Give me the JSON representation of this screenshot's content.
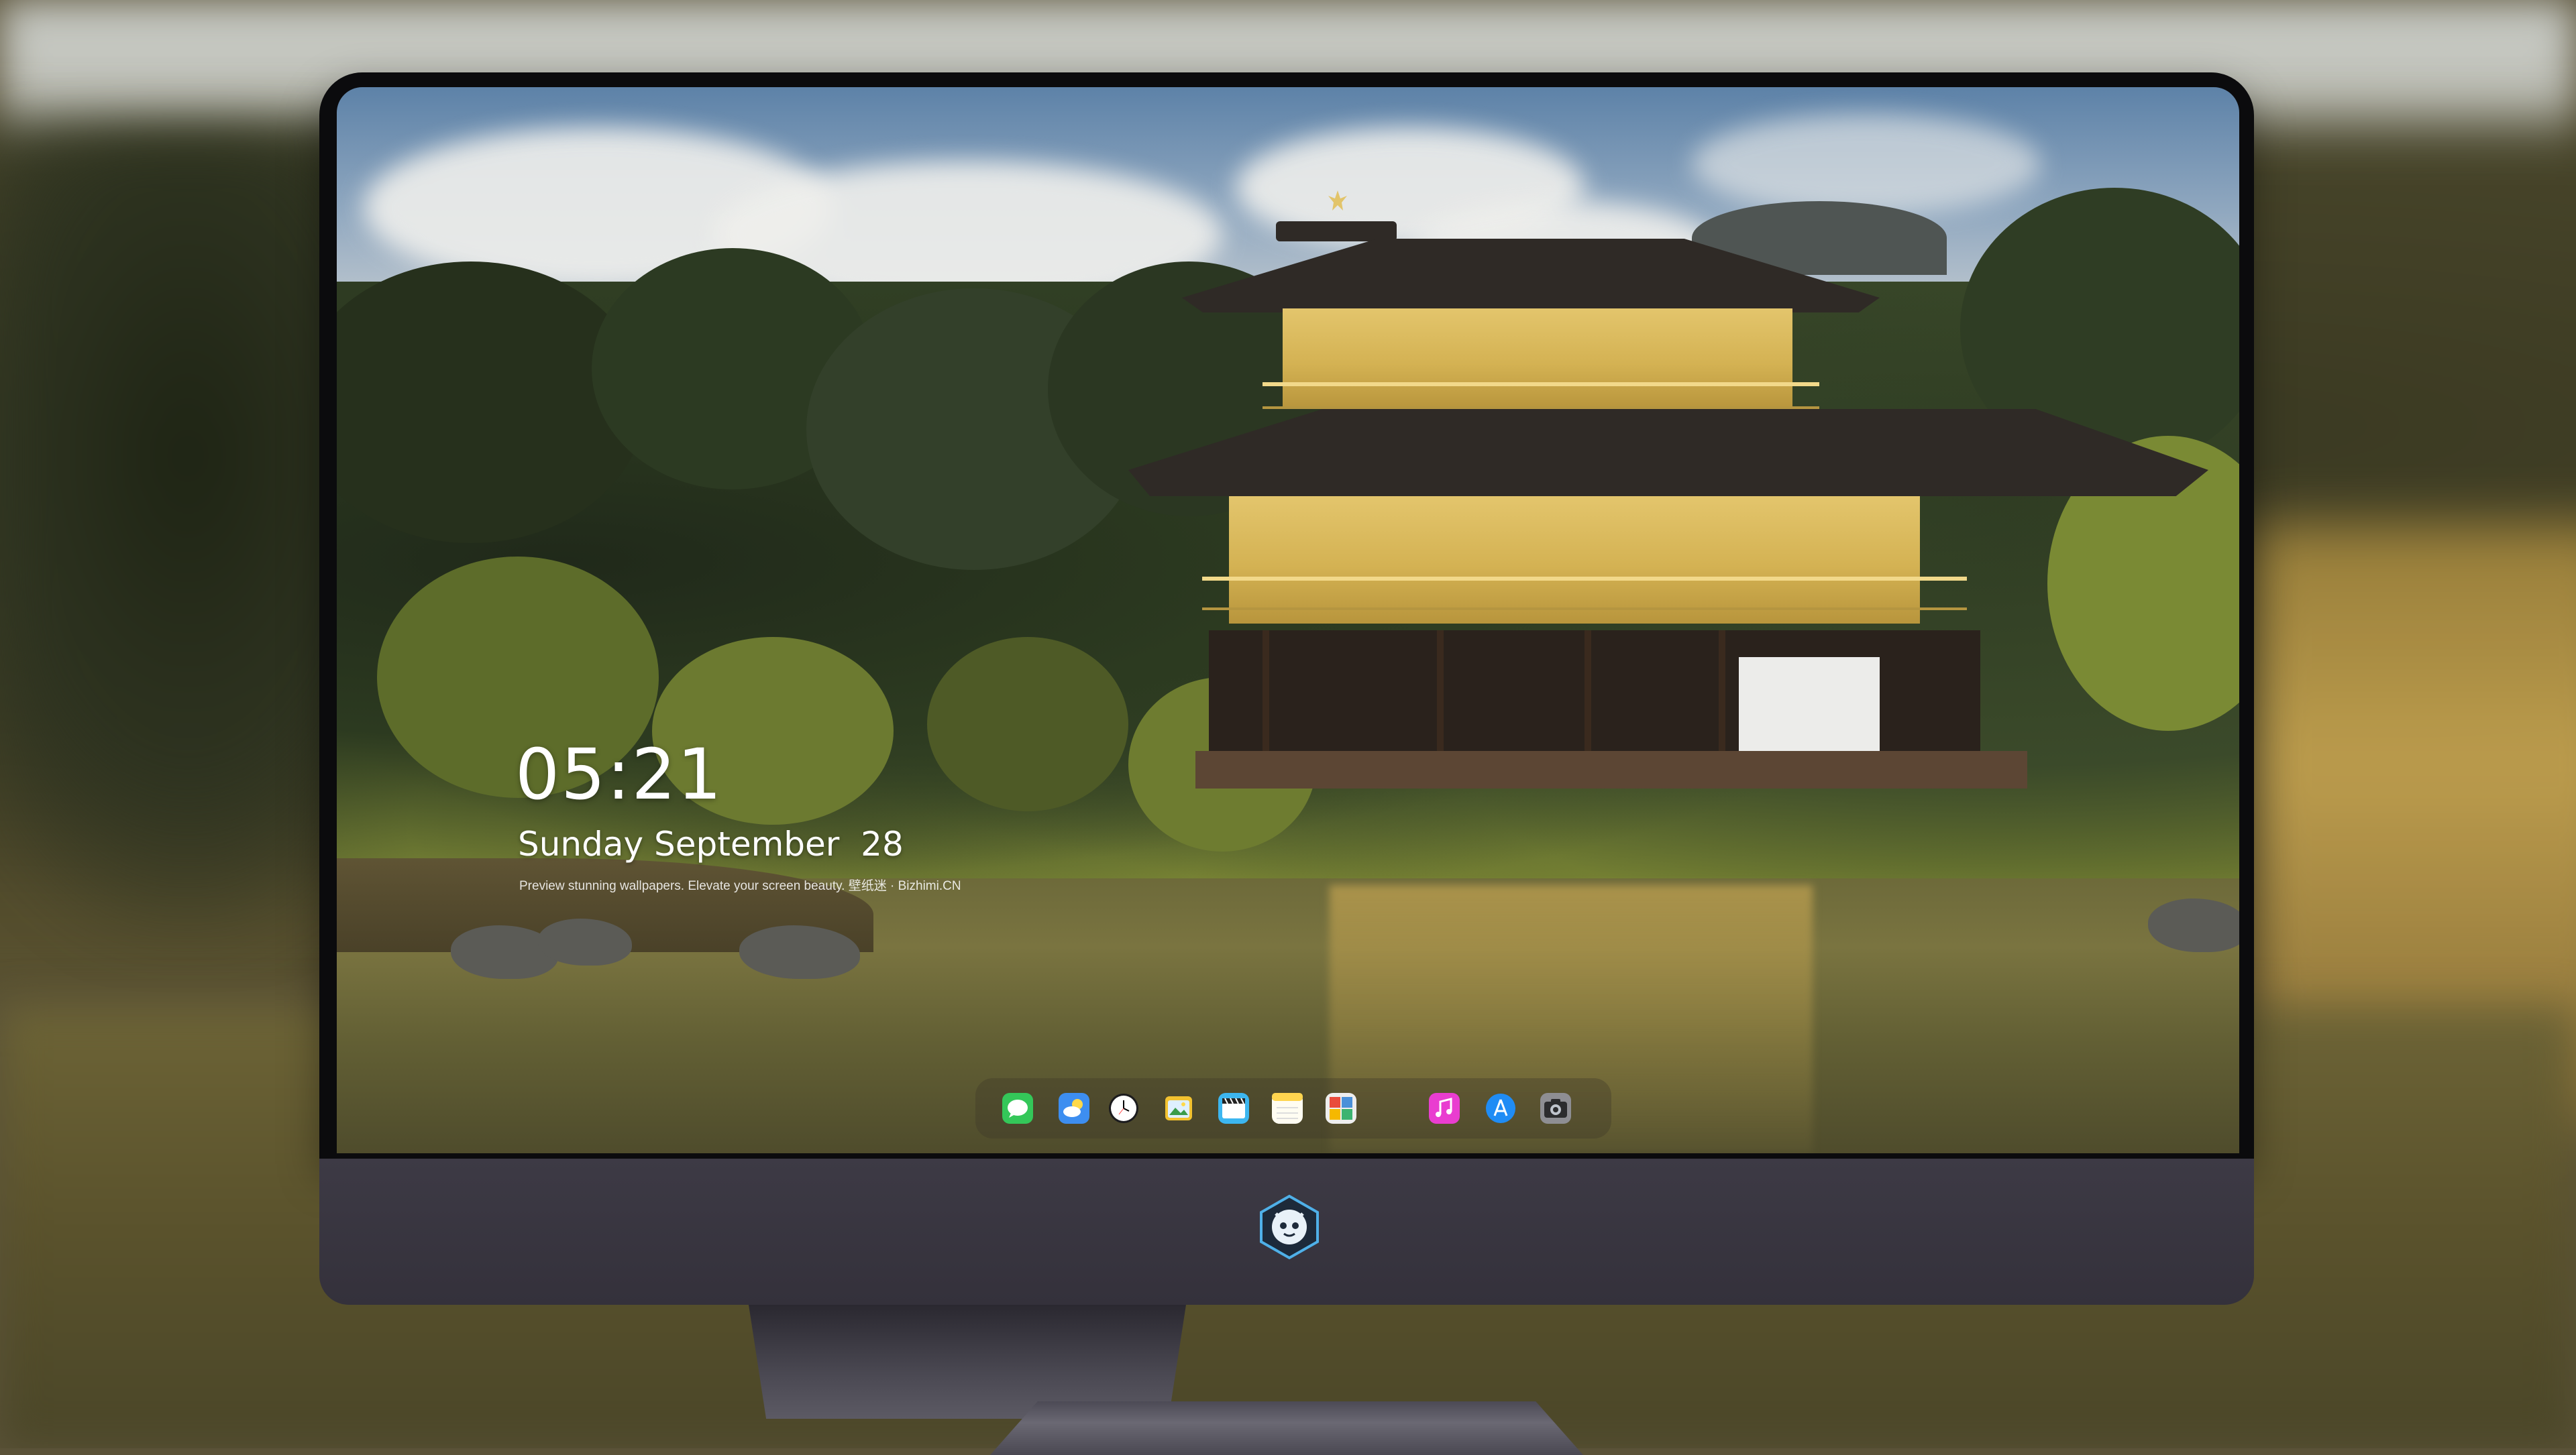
{
  "lock_screen": {
    "time": "05:21",
    "date": "Sunday September  28",
    "tagline": "Preview stunning wallpapers. Elevate your screen beauty. 壁纸迷 · Bizhimi.CN"
  },
  "dock": {
    "apps": [
      {
        "name": "Messages",
        "icon": "messages-icon",
        "color": "#34c759"
      },
      {
        "name": "Weather",
        "icon": "weather-icon",
        "color": "#3d8ef0"
      },
      {
        "name": "Clock",
        "icon": "clock-icon",
        "color": "#ffffff"
      },
      {
        "name": "Preview",
        "icon": "preview-icon",
        "color": "#f2c230"
      },
      {
        "name": "Clips",
        "icon": "clips-icon",
        "color": "#3cb6f0"
      },
      {
        "name": "Notes",
        "icon": "notes-icon",
        "color": "#ffd54f"
      },
      {
        "name": "Photo Booth",
        "icon": "photo-booth-icon",
        "color": "#4a90d9"
      },
      {
        "name": "Music",
        "icon": "music-icon",
        "color": "#e93dd0"
      },
      {
        "name": "App Store",
        "icon": "app-store-icon",
        "color": "#1f8cf5"
      },
      {
        "name": "Camera",
        "icon": "camera-icon",
        "color": "#8e8e93"
      }
    ]
  },
  "monitor": {
    "logo_icon": "bizhimi-logo-icon"
  }
}
